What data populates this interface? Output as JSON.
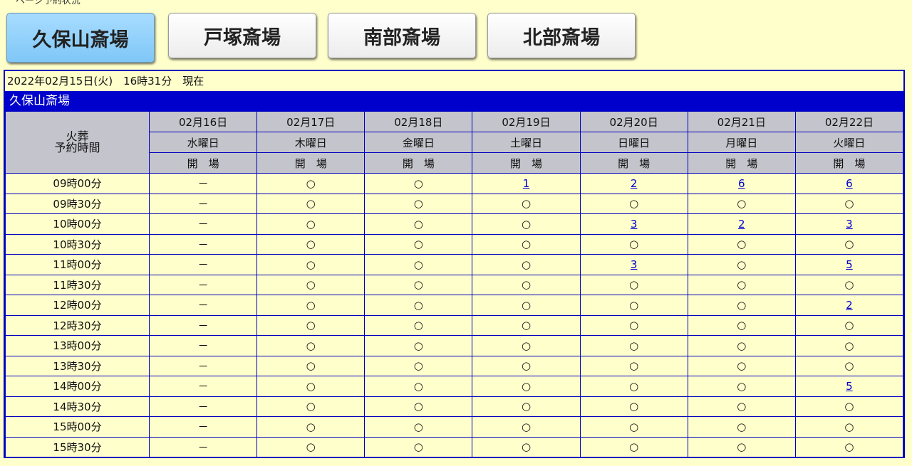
{
  "page_header_fragment": "ページ予約状況",
  "tabs": [
    {
      "label": "久保山斎場",
      "active": true
    },
    {
      "label": "戸塚斎場",
      "active": false
    },
    {
      "label": "南部斎場",
      "active": false
    },
    {
      "label": "北部斎場",
      "active": false
    }
  ],
  "status_datetime": "2022年02月15日(火)　16時31分　現在",
  "hall_name": "久保山斎場",
  "colors": {
    "accent": "#0000cc",
    "active_tab": "#8fd0fb",
    "background": "#ffffcc",
    "header_bg": "#c4c4cc"
  },
  "table": {
    "corner_label_line1": "火葬",
    "corner_label_line2": "予約時間",
    "days": [
      {
        "date": "02月16日",
        "weekday": "水曜日",
        "status": "開　場"
      },
      {
        "date": "02月17日",
        "weekday": "木曜日",
        "status": "開　場"
      },
      {
        "date": "02月18日",
        "weekday": "金曜日",
        "status": "開　場"
      },
      {
        "date": "02月19日",
        "weekday": "土曜日",
        "status": "開　場"
      },
      {
        "date": "02月20日",
        "weekday": "日曜日",
        "status": "開　場"
      },
      {
        "date": "02月21日",
        "weekday": "月曜日",
        "status": "開　場"
      },
      {
        "date": "02月22日",
        "weekday": "火曜日",
        "status": "開　場"
      }
    ],
    "rows": [
      {
        "time": "09時00分",
        "cells": [
          "－",
          "○",
          "○",
          "1",
          "2",
          "6",
          "6"
        ]
      },
      {
        "time": "09時30分",
        "cells": [
          "－",
          "○",
          "○",
          "○",
          "○",
          "○",
          "○"
        ]
      },
      {
        "time": "10時00分",
        "cells": [
          "－",
          "○",
          "○",
          "○",
          "3",
          "2",
          "3"
        ]
      },
      {
        "time": "10時30分",
        "cells": [
          "－",
          "○",
          "○",
          "○",
          "○",
          "○",
          "○"
        ]
      },
      {
        "time": "11時00分",
        "cells": [
          "－",
          "○",
          "○",
          "○",
          "3",
          "○",
          "5"
        ]
      },
      {
        "time": "11時30分",
        "cells": [
          "－",
          "○",
          "○",
          "○",
          "○",
          "○",
          "○"
        ]
      },
      {
        "time": "12時00分",
        "cells": [
          "－",
          "○",
          "○",
          "○",
          "○",
          "○",
          "2"
        ]
      },
      {
        "time": "12時30分",
        "cells": [
          "－",
          "○",
          "○",
          "○",
          "○",
          "○",
          "○"
        ]
      },
      {
        "time": "13時00分",
        "cells": [
          "－",
          "○",
          "○",
          "○",
          "○",
          "○",
          "○"
        ]
      },
      {
        "time": "13時30分",
        "cells": [
          "－",
          "○",
          "○",
          "○",
          "○",
          "○",
          "○"
        ]
      },
      {
        "time": "14時00分",
        "cells": [
          "－",
          "○",
          "○",
          "○",
          "○",
          "○",
          "5"
        ]
      },
      {
        "time": "14時30分",
        "cells": [
          "－",
          "○",
          "○",
          "○",
          "○",
          "○",
          "○"
        ]
      },
      {
        "time": "15時00分",
        "cells": [
          "－",
          "○",
          "○",
          "○",
          "○",
          "○",
          "○"
        ]
      },
      {
        "time": "15時30分",
        "cells": [
          "－",
          "○",
          "○",
          "○",
          "○",
          "○",
          "○"
        ]
      }
    ]
  }
}
